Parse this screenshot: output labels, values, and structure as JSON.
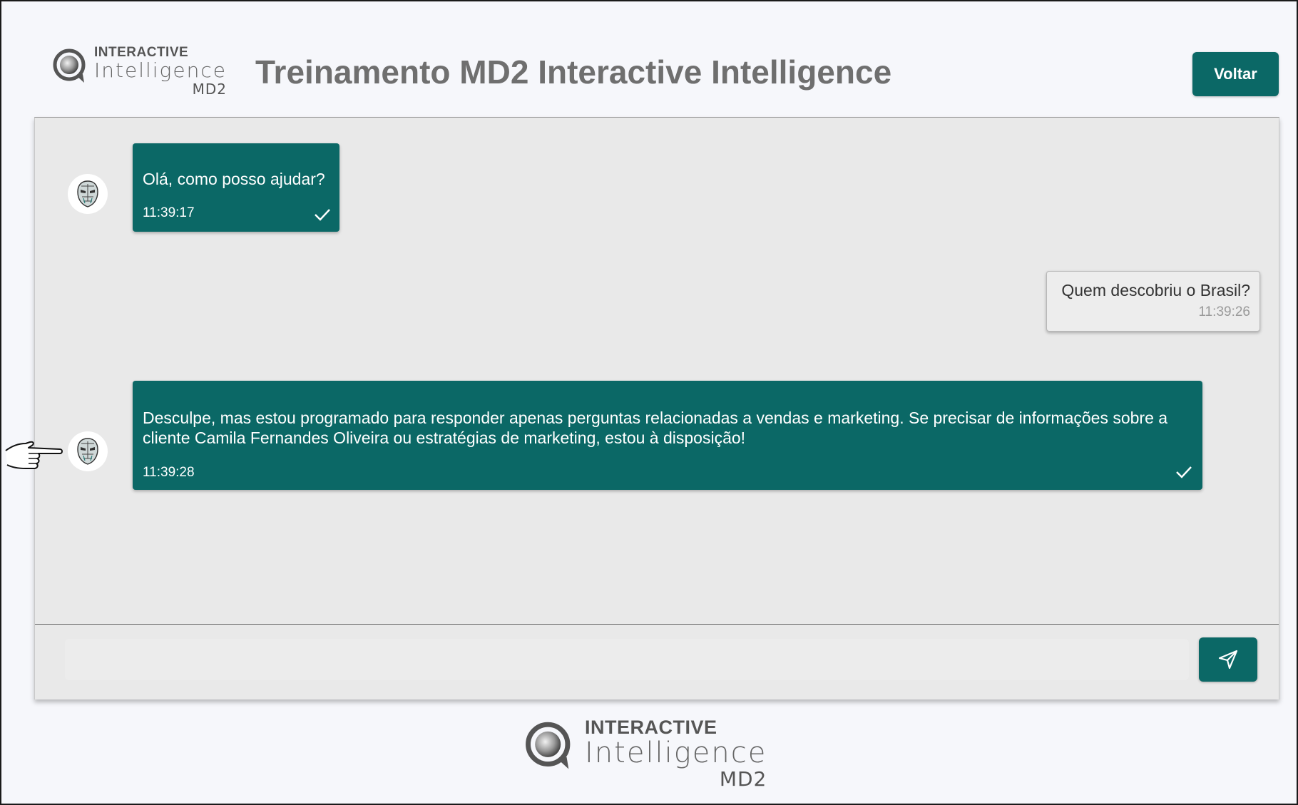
{
  "header": {
    "logo": {
      "line1": "INTERACTIVE",
      "line2": "Intelligence",
      "line3": "MD2"
    },
    "title": "Treinamento MD2 Interactive Intelligence",
    "back_label": "Voltar"
  },
  "chat": {
    "messages": [
      {
        "sender": "bot",
        "text": "Olá, como posso ajudar?",
        "time": "11:39:17"
      },
      {
        "sender": "user",
        "text": "Quem descobriu o Brasil?",
        "time": "11:39:26"
      },
      {
        "sender": "bot",
        "text": "Desculpe, mas estou programado para responder apenas perguntas relacionadas a vendas e marketing. Se precisar de informações sobre a cliente Camila Fernandes Oliveira ou estratégias de marketing, estou à disposição!",
        "time": "11:39:28"
      }
    ],
    "input": {
      "value": "",
      "placeholder": ""
    }
  },
  "footer": {
    "logo": {
      "line1": "INTERACTIVE",
      "line2": "Intelligence",
      "line3": "MD2"
    }
  },
  "icons": {
    "read_receipt": "check-icon",
    "send": "send-icon",
    "bot_avatar": "robot-face-icon",
    "pointer": "pointing-hand-icon"
  },
  "colors": {
    "accent": "#0b6866",
    "page_background": "#f6f7fb",
    "chat_background": "#e9e9e9",
    "title_text": "#6f6f6f"
  }
}
